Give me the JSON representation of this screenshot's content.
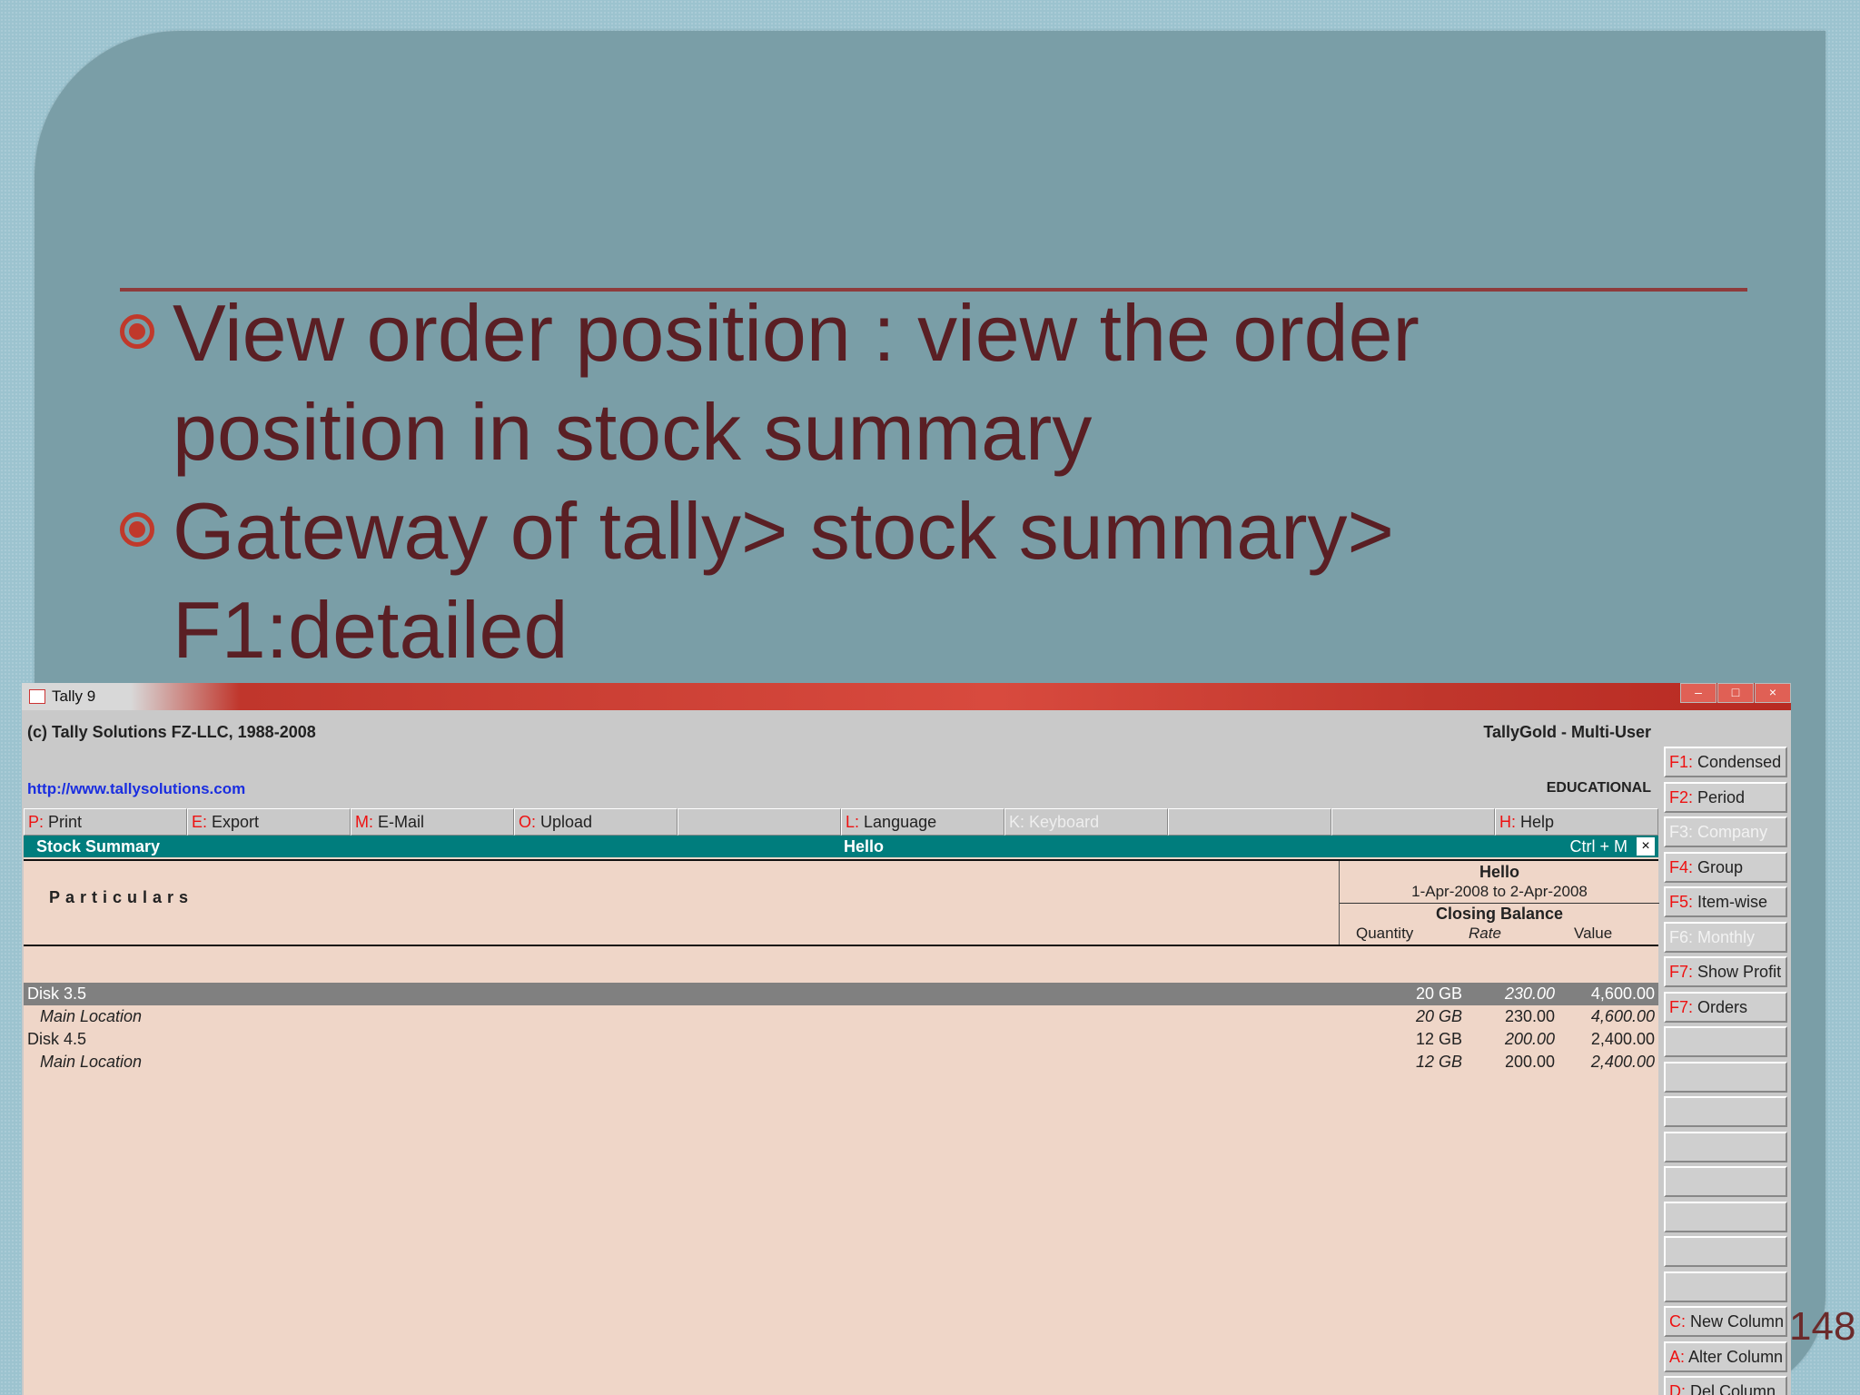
{
  "slide": {
    "bullets": [
      "View order position : view the order position in stock summary",
      "Gateway of tally> stock summary> F1:detailed"
    ],
    "page_number": "148"
  },
  "window": {
    "title": "Tally 9",
    "controls": [
      "–",
      "□",
      "×"
    ]
  },
  "header": {
    "copyright": "(c) Tally Solutions FZ-LLC, 1988-2008",
    "edition": "TallyGold - Multi-User",
    "url": "http://www.tallysolutions.com",
    "license": "EDUCATIONAL"
  },
  "button_bar": [
    {
      "key": "P:",
      "label": "Print"
    },
    {
      "key": "E:",
      "label": "Export"
    },
    {
      "key": "M:",
      "label": "E-Mail"
    },
    {
      "key": "O:",
      "label": "Upload"
    },
    {
      "key": "",
      "label": ""
    },
    {
      "key": "L:",
      "label": "Language"
    },
    {
      "key": "K:",
      "label": "Keyboard"
    },
    {
      "key": "",
      "label": ""
    },
    {
      "key": "",
      "label": ""
    },
    {
      "key": "H:",
      "label": "Help"
    }
  ],
  "report": {
    "title": "Stock Summary",
    "company": "Hello",
    "shortcut": "Ctrl + M",
    "close": "×"
  },
  "columns": {
    "particulars": "Particulars",
    "company": "Hello",
    "period": "1-Apr-2008 to 2-Apr-2008",
    "group": "Closing Balance",
    "quantity": "Quantity",
    "rate": "Rate",
    "value": "Value"
  },
  "rows": [
    {
      "name": "Disk 3.5",
      "qty": "20 GB",
      "rate": "230.00",
      "value": "4,600.00"
    },
    {
      "name": "Main Location",
      "qty": "20 GB",
      "rate": "230.00",
      "value": "4,600.00"
    },
    {
      "name": "Disk 4.5",
      "qty": "12 GB",
      "rate": "200.00",
      "value": "2,400.00"
    },
    {
      "name": "Main Location",
      "qty": "12 GB",
      "rate": "200.00",
      "value": "2,400.00"
    }
  ],
  "sidebar": [
    {
      "key": "F1:",
      "label": "Condensed"
    },
    {
      "key": "F2:",
      "label": "Period"
    },
    {
      "key": "F3:",
      "label": "Company"
    },
    {
      "key": "F4:",
      "label": "Group"
    },
    {
      "key": "F5:",
      "label": "Item-wise"
    },
    {
      "key": "F6:",
      "label": "Monthly"
    },
    {
      "key": "F7:",
      "label": "Show Profit"
    },
    {
      "key": "F7:",
      "label": "Orders"
    },
    {
      "key": "",
      "label": ""
    },
    {
      "key": "",
      "label": ""
    },
    {
      "key": "",
      "label": ""
    },
    {
      "key": "",
      "label": ""
    },
    {
      "key": "",
      "label": ""
    },
    {
      "key": "",
      "label": ""
    },
    {
      "key": "",
      "label": ""
    },
    {
      "key": "",
      "label": ""
    },
    {
      "key": "",
      "label": ""
    },
    {
      "key": "C:",
      "label": "New Column"
    },
    {
      "key": "A:",
      "label": "Alter Column"
    },
    {
      "key": "D:",
      "label": "Del Column"
    }
  ]
}
